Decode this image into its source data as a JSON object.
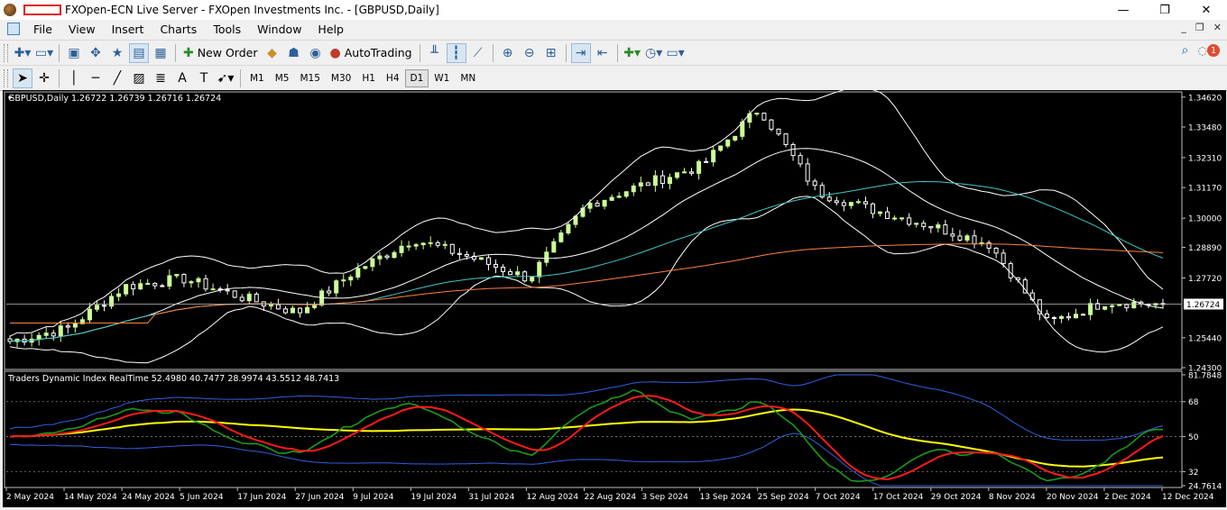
{
  "window": {
    "title": "FXOpen-ECN Live Server - FXOpen Investments Inc. - [GBPUSD,Daily]",
    "minimize": "—",
    "maximize": "❐",
    "close": "✕"
  },
  "menu": {
    "items": [
      "File",
      "View",
      "Insert",
      "Charts",
      "Tools",
      "Window",
      "Help"
    ],
    "mdi": [
      "_",
      "❐",
      "✕"
    ]
  },
  "toolbar": {
    "new_order": "New Order",
    "auto_trading": "AutoTrading",
    "notification_count": "1"
  },
  "timeframes": {
    "items": [
      "M1",
      "M5",
      "M15",
      "M30",
      "H1",
      "H4",
      "D1",
      "W1",
      "MN"
    ],
    "active": "D1"
  },
  "chart": {
    "header": "GBPUSD,Daily  1.26722 1.26739 1.26716 1.26724",
    "current_price": "1.26724",
    "price_ticks": [
      "1.34620",
      "1.33480",
      "1.32310",
      "1.31170",
      "1.30000",
      "1.28890",
      "1.27720",
      "1.25440",
      "1.24300"
    ],
    "indicator_header": "Traders Dynamic Index RealTime 52.4980 40.7477 28.9974 43.5512 48.7413",
    "indicator_ticks": [
      "81.7848",
      "68",
      "50",
      "32",
      "24.7614"
    ],
    "date_ticks": [
      "2 May 2024",
      "14 May 2024",
      "24 May 2024",
      "5 Jun 2024",
      "17 Jun 2024",
      "27 Jun 2024",
      "9 Jul 2024",
      "19 Jul 2024",
      "31 Jul 2024",
      "12 Aug 2024",
      "22 Aug 2024",
      "3 Sep 2024",
      "13 Sep 2024",
      "25 Sep 2024",
      "7 Oct 2024",
      "17 Oct 2024",
      "29 Oct 2024",
      "8 Nov 2024",
      "20 Nov 2024",
      "2 Dec 2024",
      "12 Dec 2024"
    ],
    "colors": {
      "bull_candle": "#ccff99",
      "bear_candle": "#ffffff",
      "bollinger": "#ffffff",
      "ma_fast": "#40c8c8",
      "ma_slow": "#ff8040",
      "tdi_green": "#1a9a1a",
      "tdi_red": "#ff1a1a",
      "tdi_yellow": "#ffff00",
      "tdi_bands": "#3060e0"
    }
  },
  "chart_data": {
    "type": "candlestick",
    "symbol": "GBPUSD",
    "timeframe": "Daily",
    "ylim": [
      1.243,
      1.3475
    ],
    "close_key_points": [
      [
        "2 May 2024",
        1.253
      ],
      [
        "14 May 2024",
        1.258
      ],
      [
        "24 May 2024",
        1.274
      ],
      [
        "5 Jun 2024",
        1.277
      ],
      [
        "17 Jun 2024",
        1.27
      ],
      [
        "27 Jun 2024",
        1.264
      ],
      [
        "9 Jul 2024",
        1.28
      ],
      [
        "19 Jul 2024",
        1.292
      ],
      [
        "31 Jul 2024",
        1.285
      ],
      [
        "12 Aug 2024",
        1.277
      ],
      [
        "22 Aug 2024",
        1.305
      ],
      [
        "3 Sep 2024",
        1.313
      ],
      [
        "13 Sep 2024",
        1.32
      ],
      [
        "25 Sep 2024",
        1.342
      ],
      [
        "7 Oct 2024",
        1.31
      ],
      [
        "17 Oct 2024",
        1.303
      ],
      [
        "29 Oct 2024",
        1.297
      ],
      [
        "8 Nov 2024",
        1.29
      ],
      [
        "20 Nov 2024",
        1.26
      ],
      [
        "2 Dec 2024",
        1.268
      ],
      [
        "12 Dec 2024",
        1.2672
      ]
    ],
    "tdi_ylim": [
      24.7614,
      81.7848
    ],
    "tdi_levels": [
      68,
      50,
      32
    ]
  }
}
